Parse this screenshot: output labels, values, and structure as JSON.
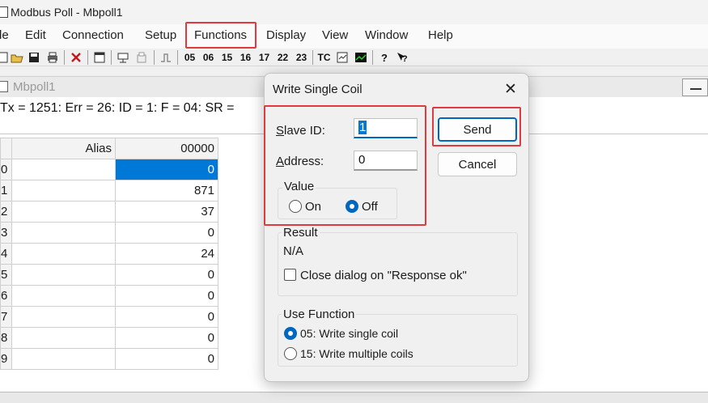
{
  "window": {
    "title": "Modbus Poll - Mbpoll1"
  },
  "menu": [
    "le",
    "Edit",
    "Connection",
    "Setup",
    "Functions",
    "Display",
    "View",
    "Window",
    "Help"
  ],
  "toolbar": {
    "func_codes": [
      "05",
      "06",
      "15",
      "16",
      "17",
      "22",
      "23"
    ],
    "tc_label": "TC"
  },
  "child": {
    "title": "Mbpoll1",
    "status": "Tx = 1251: Err = 26: ID = 1: F = 04: SR ="
  },
  "grid": {
    "headers": {
      "alias": "Alias",
      "address": "00000"
    },
    "rows": [
      {
        "idx": "0",
        "alias": "",
        "value": "0"
      },
      {
        "idx": "1",
        "alias": "",
        "value": "871"
      },
      {
        "idx": "2",
        "alias": "",
        "value": "37"
      },
      {
        "idx": "3",
        "alias": "",
        "value": "0"
      },
      {
        "idx": "4",
        "alias": "",
        "value": "24"
      },
      {
        "idx": "5",
        "alias": "",
        "value": "0"
      },
      {
        "idx": "6",
        "alias": "",
        "value": "0"
      },
      {
        "idx": "7",
        "alias": "",
        "value": "0"
      },
      {
        "idx": "8",
        "alias": "",
        "value": "0"
      },
      {
        "idx": "9",
        "alias": "",
        "value": "0"
      }
    ]
  },
  "dialog": {
    "title": "Write Single Coil",
    "close_glyph": "✕",
    "slave_id_label_u": "S",
    "slave_id_label_rest": "lave ID:",
    "slave_id_value": "1",
    "address_label_u": "A",
    "address_label_rest": "ddress:",
    "address_value": "0",
    "value_group": "Value",
    "on_label": "On",
    "off_label": "Off",
    "send_label": "Send",
    "cancel_label": "Cancel",
    "result_group": "Result",
    "result_value": "N/A",
    "close_on_ok_label": "Close dialog on \"Response ok\"",
    "use_function_group": "Use Function",
    "func_05": "05: Write single coil",
    "func_15": "15: Write multiple coils"
  },
  "colors": {
    "highlight": "#e0393e",
    "accent": "#0078d7"
  }
}
